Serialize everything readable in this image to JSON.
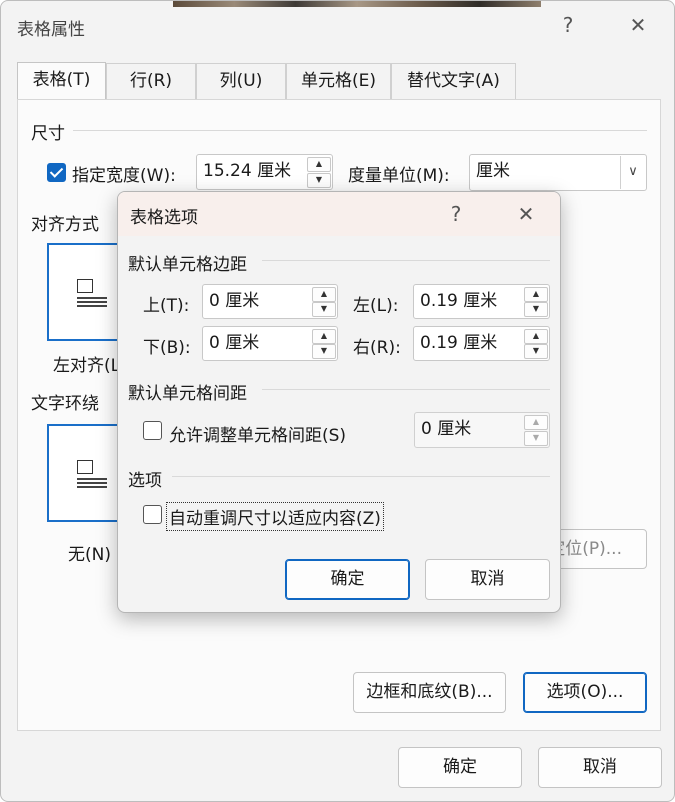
{
  "outer_dialog": {
    "title": "表格属性",
    "help": "?",
    "close": "✕",
    "tabs": [
      {
        "label": "表格(T)"
      },
      {
        "label": "行(R)"
      },
      {
        "label": "列(U)"
      },
      {
        "label": "单元格(E)"
      },
      {
        "label": "替代文字(A)"
      }
    ],
    "size_section": "尺寸",
    "preferred_width_checkbox": "指定宽度(W):",
    "preferred_width_checked": true,
    "preferred_width_value": "15.24 厘米",
    "measure_in_label": "度量单位(M):",
    "measure_in_value": "厘米",
    "alignment_section": "对齐方式",
    "alignment_left_label": "左对齐(L",
    "text_wrap_section": "文字环绕",
    "wrap_none_label": "无(N)",
    "positioning_button": "定位(P)...",
    "borders_button": "边框和底纹(B)...",
    "options_button": "选项(O)...",
    "ok_button": "确定",
    "cancel_button": "取消"
  },
  "inner_dialog": {
    "title": "表格选项",
    "help": "?",
    "close": "✕",
    "margins_section": "默认单元格边距",
    "top_label": "上(T):",
    "top_value": "0 厘米",
    "left_label": "左(L):",
    "left_value": "0.19 厘米",
    "bottom_label": "下(B):",
    "bottom_value": "0 厘米",
    "right_label": "右(R):",
    "right_value": "0.19 厘米",
    "spacing_section": "默认单元格间距",
    "allow_spacing_label": "允许调整单元格间距(S)",
    "allow_spacing_checked": false,
    "spacing_value": "0 厘米",
    "options_section": "选项",
    "autoresize_label": "自动重调尺寸以适应内容(Z)",
    "autoresize_checked": false,
    "ok_button": "确定",
    "cancel_button": "取消"
  },
  "colors": {
    "accent": "#1067c2",
    "dialog_bg": "#f3f3f3",
    "inner_title_bg": "#f8efec"
  }
}
